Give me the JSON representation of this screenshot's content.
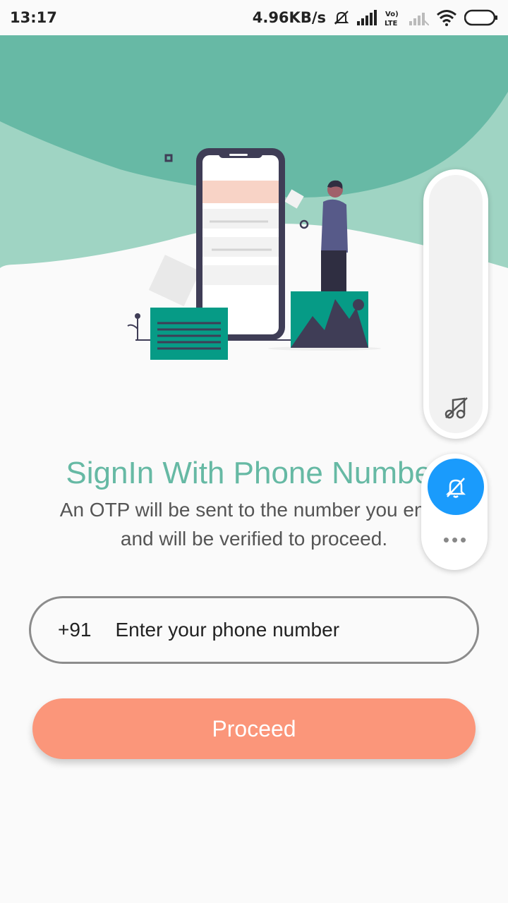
{
  "status_bar": {
    "time": "13:17",
    "speed": "4.96KB/s",
    "icons": [
      "mute-icon",
      "signal-icon",
      "volte-icon",
      "signal-off-icon",
      "wifi-icon",
      "battery-icon"
    ]
  },
  "main": {
    "title": "SignIn With Phone Number",
    "subtitle_line1": "An OTP will be sent to the number you enter",
    "subtitle_line2": "and will be verified to proceed."
  },
  "phone": {
    "prefix": "+91",
    "placeholder": "Enter your phone number",
    "value": ""
  },
  "proceed_label": "Proceed",
  "floating_menu": {
    "icons": [
      "music-off-icon",
      "bell-off-icon",
      "more-icon"
    ],
    "more": "•••"
  },
  "colors": {
    "accent_teal": "#66b9a4",
    "button_coral": "#fb967a",
    "floating_blue": "#1a9bfc"
  }
}
